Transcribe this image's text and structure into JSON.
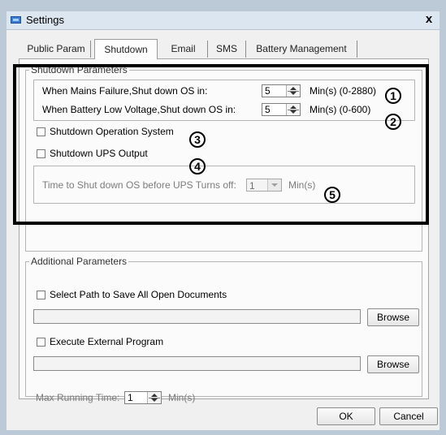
{
  "window": {
    "title": "Settings",
    "close_glyph": "x"
  },
  "tabs": [
    {
      "label": "Public Param"
    },
    {
      "label": "Shutdown",
      "active": true
    },
    {
      "label": "Email"
    },
    {
      "label": "SMS"
    },
    {
      "label": "Battery Management"
    }
  ],
  "shutdown_params": {
    "legend": "Shutdown Parameters",
    "mains_failure": {
      "label": "When Mains Failure,Shut down OS in:",
      "value": "5",
      "unit_range": "Min(s) (0-2880)"
    },
    "battery_low": {
      "label": "When Battery Low Voltage,Shut down OS in:",
      "value": "5",
      "unit_range": "Min(s) (0-600)"
    },
    "shutdown_os": {
      "label": "Shutdown Operation System",
      "checked": false
    },
    "shutdown_ups": {
      "label": "Shutdown UPS Output",
      "checked": false
    },
    "time_before_ups": {
      "label": "Time to Shut down OS before UPS Turns off:",
      "value": "1",
      "unit": "Min(s)"
    }
  },
  "annotations": [
    "1",
    "2",
    "3",
    "4",
    "5"
  ],
  "additional_params": {
    "legend": "Additional Parameters",
    "save_docs": {
      "label": "Select Path to Save All Open Documents",
      "checked": false,
      "path": "",
      "browse_label": "Browse"
    },
    "external_program": {
      "label": "Execute External Program",
      "checked": false,
      "path": "",
      "browse_label": "Browse"
    },
    "max_running": {
      "label": "Max Running Time:",
      "value": "1",
      "unit": "Min(s)"
    }
  },
  "footer": {
    "ok_label": "OK",
    "cancel_label": "Cancel"
  },
  "colors": {
    "titlebar": "#dce6f0",
    "dialog_bg": "#f0f0f0",
    "highlight_border": "#000000",
    "disabled_text": "#7c7c7c"
  },
  "icons": [
    "settings-app-icon",
    "close-icon",
    "spin-up-icon",
    "spin-down-icon",
    "dropdown-arrow-icon",
    "checkbox-icon"
  ]
}
